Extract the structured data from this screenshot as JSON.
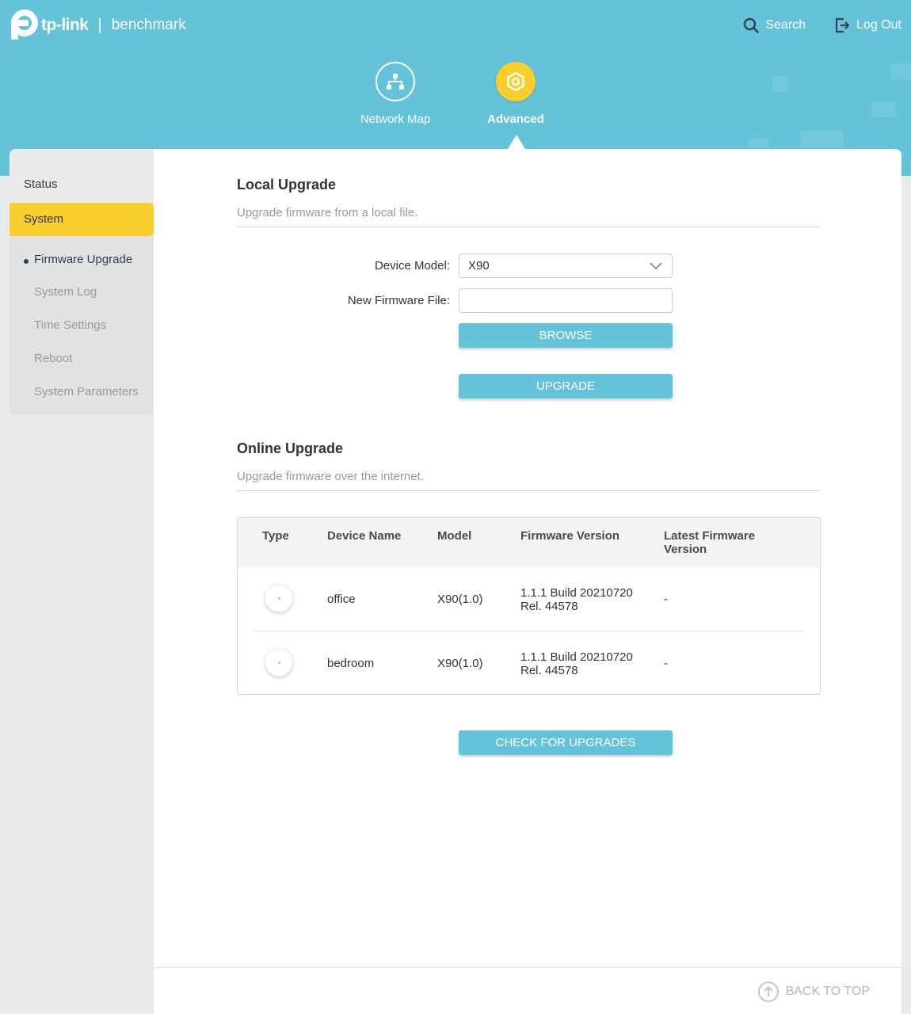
{
  "header": {
    "brand": "tp-link",
    "separator": "|",
    "product": "benchmark",
    "search_label": "Search",
    "logout_label": "Log Out",
    "accent_color": "#64c3d9",
    "highlight_color": "#f9ce2f"
  },
  "nav": {
    "network_map": "Network Map",
    "advanced": "Advanced"
  },
  "sidebar": {
    "status": "Status",
    "system": "System",
    "sub_items": [
      {
        "label": "Firmware Upgrade"
      },
      {
        "label": "System Log"
      },
      {
        "label": "Time Settings"
      },
      {
        "label": "Reboot"
      },
      {
        "label": "System Parameters"
      }
    ]
  },
  "local_upgrade": {
    "title": "Local Upgrade",
    "subtitle": "Upgrade firmware from a local file.",
    "device_model_label": "Device Model:",
    "device_model_value": "X90",
    "firmware_file_label": "New Firmware File:",
    "firmware_file_value": "",
    "browse_label": "BROWSE",
    "upgrade_label": "UPGRADE"
  },
  "online_upgrade": {
    "title": "Online Upgrade",
    "subtitle": "Upgrade firmware over the internet.",
    "columns": [
      "Type",
      "Device Name",
      "Model",
      "Firmware Version",
      "Latest Firmware Version"
    ],
    "rows": [
      {
        "type_icon": "deco-device-icon",
        "device_name": "office",
        "model": "X90(1.0)",
        "firmware_line1": "1.1.1 Build 20210720",
        "firmware_line2": "Rel. 44578",
        "latest": "-"
      },
      {
        "type_icon": "deco-device-icon",
        "device_name": "bedroom",
        "model": "X90(1.0)",
        "firmware_line1": "1.1.1 Build 20210720",
        "firmware_line2": "Rel. 44578",
        "latest": "-"
      }
    ],
    "check_label": "CHECK FOR UPGRADES"
  },
  "footer": {
    "back_to_top": "BACK TO TOP"
  }
}
